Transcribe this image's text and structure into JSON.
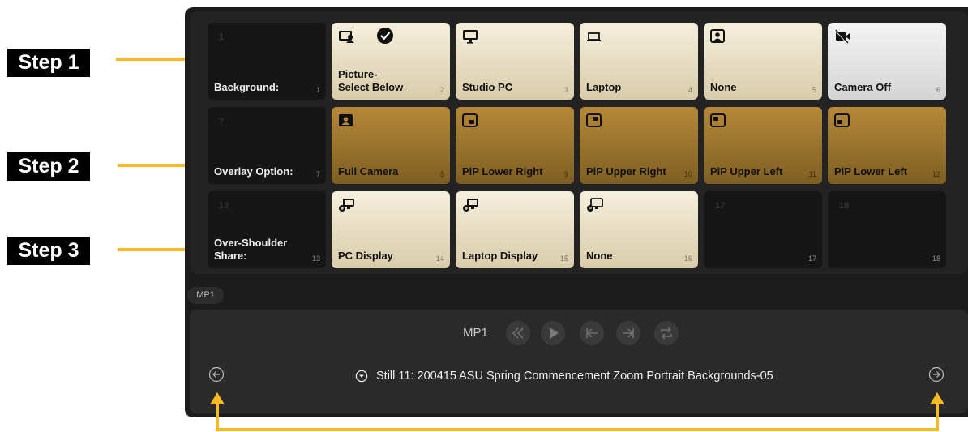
{
  "steps": [
    {
      "label": "Step 1"
    },
    {
      "label": "Step 2"
    },
    {
      "label": "Step 3"
    }
  ],
  "colors": {
    "accent": "#f7b928",
    "tile_gold": "#b68838",
    "tile_cream": "#f5efdc",
    "panel": "#1c1c1c"
  },
  "rows": [
    [
      {
        "top_number": "1",
        "label": "Background:",
        "number": "1",
        "style": "dark",
        "icon": ""
      },
      {
        "top_number": "",
        "label": "Picture-\nSelect Below",
        "number": "2",
        "style": "light",
        "icon": "picture-icon",
        "checked": true
      },
      {
        "top_number": "",
        "label": "Studio PC",
        "number": "3",
        "style": "light",
        "icon": "desktop-icon"
      },
      {
        "top_number": "",
        "label": "Laptop",
        "number": "4",
        "style": "light",
        "icon": "laptop-icon"
      },
      {
        "top_number": "",
        "label": "None",
        "number": "5",
        "style": "light",
        "icon": "person-icon"
      },
      {
        "top_number": "",
        "label": "Camera Off",
        "number": "6",
        "style": "gray",
        "icon": "camera-off-icon"
      }
    ],
    [
      {
        "top_number": "7",
        "label": "Overlay Option:",
        "number": "7",
        "style": "dark",
        "icon": ""
      },
      {
        "top_number": "",
        "label": "Full Camera",
        "number": "8",
        "style": "gold",
        "icon": "full-camera-icon"
      },
      {
        "top_number": "",
        "label": "PiP Lower Right",
        "number": "9",
        "style": "gold",
        "icon": "pip-lower-right-icon"
      },
      {
        "top_number": "",
        "label": "PiP Upper Right",
        "number": "10",
        "style": "gold",
        "icon": "pip-upper-right-icon"
      },
      {
        "top_number": "",
        "label": "PiP Upper Left",
        "number": "11",
        "style": "gold",
        "icon": "pip-upper-left-icon"
      },
      {
        "top_number": "",
        "label": "PiP Lower Left",
        "number": "12",
        "style": "gold",
        "icon": "pip-lower-left-icon"
      }
    ],
    [
      {
        "top_number": "13",
        "label": "Over-Shoulder\nShare:",
        "number": "13",
        "style": "dark",
        "icon": ""
      },
      {
        "top_number": "",
        "label": "PC Display",
        "number": "14",
        "style": "light",
        "icon": "add-display-icon"
      },
      {
        "top_number": "",
        "label": "Laptop Display",
        "number": "15",
        "style": "light",
        "icon": "add-display-icon"
      },
      {
        "top_number": "",
        "label": "None",
        "number": "16",
        "style": "light",
        "icon": "remove-display-icon"
      },
      {
        "top_number": "17",
        "label": "",
        "number": "17",
        "style": "dark",
        "icon": ""
      },
      {
        "top_number": "18",
        "label": "",
        "number": "18",
        "style": "dark",
        "icon": ""
      }
    ]
  ],
  "media_player": {
    "tab_label": "MP1",
    "title": "MP1",
    "controls": [
      "rewind-icon",
      "play-icon",
      "skip-to-start-icon",
      "skip-to-end-icon",
      "loop-icon"
    ],
    "status_text": "Still 11: 200415 ASU Spring Commencement Zoom Portrait Backgrounds-05"
  }
}
